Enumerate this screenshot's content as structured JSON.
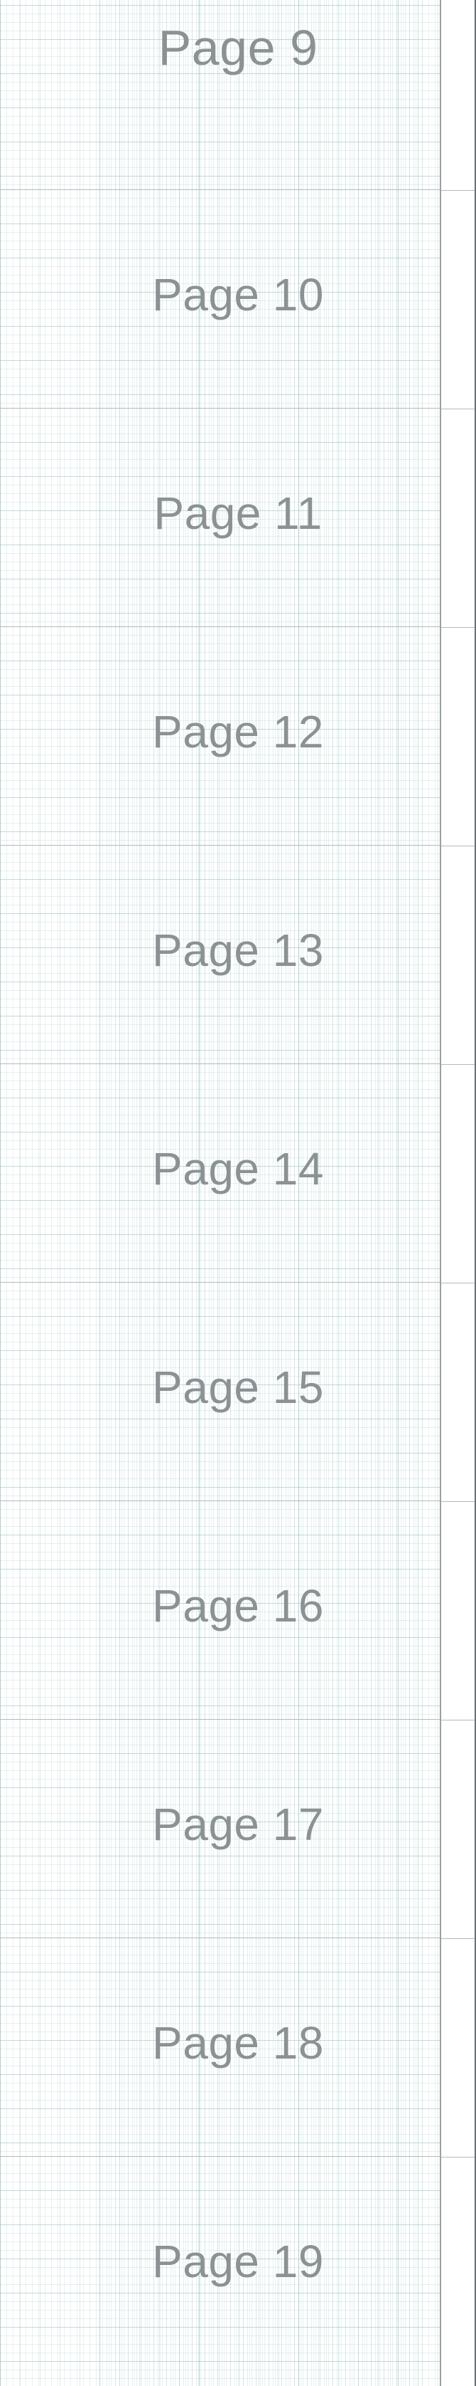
{
  "viewer": {
    "pages": [
      {
        "label": "Page 9"
      },
      {
        "label": "Page 10"
      },
      {
        "label": "Page 11"
      },
      {
        "label": "Page 12"
      },
      {
        "label": "Page 13"
      },
      {
        "label": "Page 14"
      },
      {
        "label": "Page 15"
      },
      {
        "label": "Page 16"
      },
      {
        "label": "Page 17"
      },
      {
        "label": "Page 18"
      },
      {
        "label": "Page 19"
      }
    ]
  },
  "colors": {
    "page_label": "#8c9194",
    "grid_line": "#8bb5b5",
    "page_divider": "#b5b9bb",
    "edge": "#6b7073"
  }
}
